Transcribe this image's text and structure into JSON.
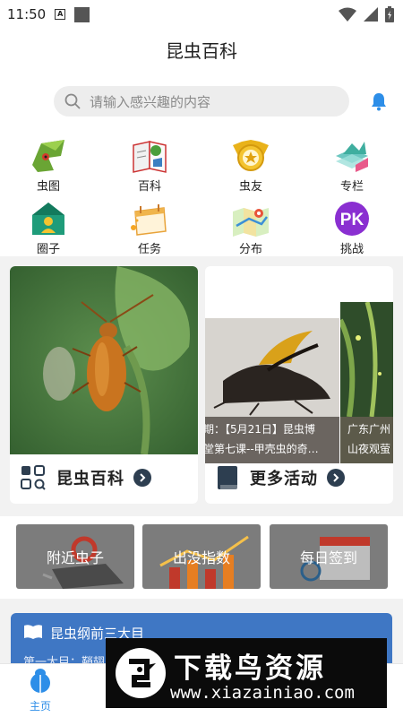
{
  "status_bar": {
    "time": "11:50"
  },
  "app": {
    "title": "昆虫百科"
  },
  "search": {
    "placeholder": "请输入感兴趣的内容"
  },
  "categories": [
    {
      "label": "虫图",
      "icon": "insect-picture-icon"
    },
    {
      "label": "百科",
      "icon": "encyclopedia-icon"
    },
    {
      "label": "虫友",
      "icon": "friends-badge-icon"
    },
    {
      "label": "专栏",
      "icon": "column-icon"
    },
    {
      "label": "圈子",
      "icon": "circle-home-icon"
    },
    {
      "label": "任务",
      "icon": "task-calendar-icon"
    },
    {
      "label": "分布",
      "icon": "distribution-map-icon"
    },
    {
      "label": "挑战",
      "icon": "pk-challenge-icon",
      "badge": "PK"
    }
  ],
  "cards": {
    "left": {
      "label": "昆虫百科"
    },
    "right": {
      "label": "更多活动",
      "slide1_line1": "期：【5月21日】昆虫博",
      "slide1_line2": "堂第七课--甲壳虫的奇…",
      "slide2_line1": "广东广州",
      "slide2_line2": "山夜观萤"
    }
  },
  "promos": [
    {
      "label": "附近虫子"
    },
    {
      "label": "出没指数"
    },
    {
      "label": "每日签到"
    }
  ],
  "bottom_card": {
    "title": "昆虫纲前三大目",
    "subtitle": "第一大目：鞘翅"
  },
  "tabbar": {
    "home_label": "主页"
  },
  "watermark": {
    "title": "下载鸟资源",
    "url": "www.xiazainiao.com"
  },
  "colors": {
    "accent": "#2d8ee8",
    "card_blue": "#3f77c4",
    "dark_navy": "#2d3e50"
  }
}
